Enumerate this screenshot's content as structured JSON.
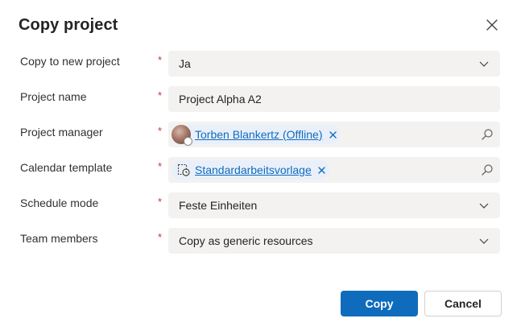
{
  "dialog": {
    "title": "Copy project",
    "close_icon": "close-icon"
  },
  "fields": {
    "copy_to_new_project": {
      "label": "Copy to new project",
      "required": "*",
      "value": "Ja",
      "icon": "chevron-down-icon"
    },
    "project_name": {
      "label": "Project name",
      "required": "*",
      "value": "Project Alpha A2"
    },
    "project_manager": {
      "label": "Project manager",
      "required": "*",
      "value": "Torben Blankertz (Offline)",
      "icon": "search-icon"
    },
    "calendar_template": {
      "label": "Calendar template",
      "required": "*",
      "value": "Standardarbeitsvorlage",
      "icon": "search-icon"
    },
    "schedule_mode": {
      "label": "Schedule mode",
      "required": "*",
      "value": "Feste Einheiten",
      "icon": "chevron-down-icon"
    },
    "team_members": {
      "label": "Team members",
      "required": "*",
      "value": "Copy as generic resources",
      "icon": "chevron-down-icon"
    }
  },
  "buttons": {
    "copy": "Copy",
    "cancel": "Cancel"
  },
  "colors": {
    "primary": "#0f6cbd",
    "required": "#c4314b",
    "field_bg": "#f3f2f1",
    "link": "#0f6cbd"
  }
}
